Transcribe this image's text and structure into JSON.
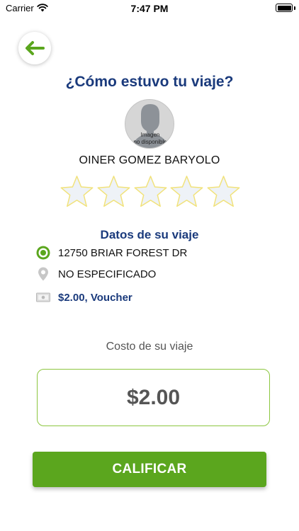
{
  "status_bar": {
    "carrier": "Carrier",
    "time": "7:47 PM"
  },
  "header": {
    "title": "¿Cómo estuvo tu viaje?"
  },
  "driver": {
    "avatar_caption_line1": "Imagen",
    "avatar_caption_line2": "no disponible",
    "name": "OINER GOMEZ BARYOLO"
  },
  "rating": {
    "value": 0,
    "max": 5
  },
  "trip": {
    "section_title": "Datos de su viaje",
    "origin": "12750 BRIAR FOREST DR",
    "destination": "NO ESPECIFICADO",
    "payment": "$2.00, Voucher"
  },
  "cost": {
    "label": "Costo de su viaje",
    "value": "$2.00"
  },
  "actions": {
    "rate_label": "CALIFICAR"
  },
  "colors": {
    "accent_green": "#5ba61e",
    "border_green": "#8cc63f",
    "navy": "#1a3a7c",
    "star_fill": "#eef2f7",
    "star_stroke": "#f1e27a"
  }
}
